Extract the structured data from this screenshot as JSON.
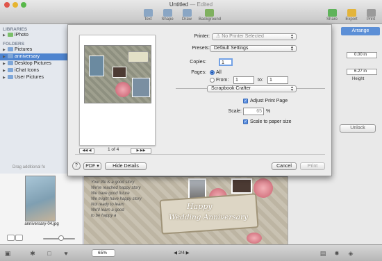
{
  "window": {
    "title": "Untitled",
    "edited": "— Edited"
  },
  "toolbar": {
    "left": [
      {
        "label": "Text",
        "icon": "text-icon"
      },
      {
        "label": "Shape",
        "icon": "shape-icon"
      },
      {
        "label": "Draw",
        "icon": "draw-icon"
      },
      {
        "label": "Background",
        "icon": "background-icon"
      }
    ],
    "right": [
      {
        "label": "Share",
        "icon": "share-icon"
      },
      {
        "label": "Export",
        "icon": "export-icon"
      },
      {
        "label": "Print",
        "icon": "print-icon"
      }
    ]
  },
  "sidebar": {
    "libraries_header": "LIBRARIES",
    "iphoto": "iPhoto",
    "folders_header": "FOLDERS",
    "folders": [
      "Pictures",
      "anniversary",
      "Desktop Pictures",
      "iChat Icons",
      "User Pictures"
    ],
    "selected_folder": "anniversary",
    "footer": "Drag additional fo"
  },
  "browser": {
    "thumbnail_caption": "anniversary-04.jpg"
  },
  "canvas": {
    "page_text": [
      "Your life is a good story",
      "We're reached happy story",
      "We have good future",
      "We might have happy story",
      "Not ready to learn",
      "We'll learn a good",
      "to be happy a"
    ],
    "banner_line1": "Happy",
    "banner_line2": "Wedding Anniversary"
  },
  "inspector": {
    "tab": "Arrange",
    "field_x": "0.00 in",
    "field_height": "6.27 in",
    "height_label": "Height",
    "unlock_button": "Unlock"
  },
  "print_dialog": {
    "printer_label": "Printer:",
    "printer_value": "No Printer Selected",
    "presets_label": "Presets:",
    "presets_value": "Default Settings",
    "copies_label": "Copies:",
    "copies_value": "1",
    "pages_label": "Pages:",
    "pages_all": "All",
    "pages_from_label": "From:",
    "pages_from_value": "1",
    "pages_to_label": "to:",
    "pages_to_value": "1",
    "section_value": "Scrapbook Crafter",
    "adjust_print_page": "Adjust Print Page",
    "scale_label": "Scale:",
    "scale_value": "65",
    "scale_unit": "%",
    "scale_to_paper": "Scale to paper size",
    "preview_page": "1 of 4",
    "help_button": "?",
    "pdf_button": "PDF",
    "hide_details_button": "Hide Details",
    "cancel_button": "Cancel",
    "print_button": "Print"
  },
  "bottombar": {
    "zoom": "65%",
    "page_indicator": "2/4"
  }
}
